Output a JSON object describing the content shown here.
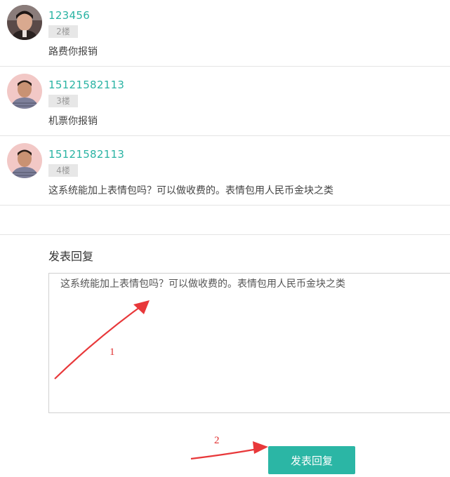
{
  "comments": [
    {
      "user": "123456",
      "floor": "2楼",
      "text": "路费你报销",
      "avatar_icon": "user-avatar-1-icon"
    },
    {
      "user": "15121582113",
      "floor": "3楼",
      "text": "机票你报销",
      "avatar_icon": "user-avatar-2-icon"
    },
    {
      "user": "15121582113",
      "floor": "4楼",
      "text": "这系统能加上表情包吗？可以做收费的。表情包用人民币金块之类",
      "avatar_icon": "user-avatar-2-icon"
    }
  ],
  "reply": {
    "title": "发表回复",
    "value": "这系统能加上表情包吗？可以做收费的。表情包用人民币金块之类",
    "submit_label": "发表回复"
  },
  "annotations": {
    "arrow1_label": "1",
    "arrow2_label": "2",
    "color": "#e8383a"
  },
  "colors": {
    "accent": "#2bb6a5",
    "username": "#2ab3a3"
  }
}
